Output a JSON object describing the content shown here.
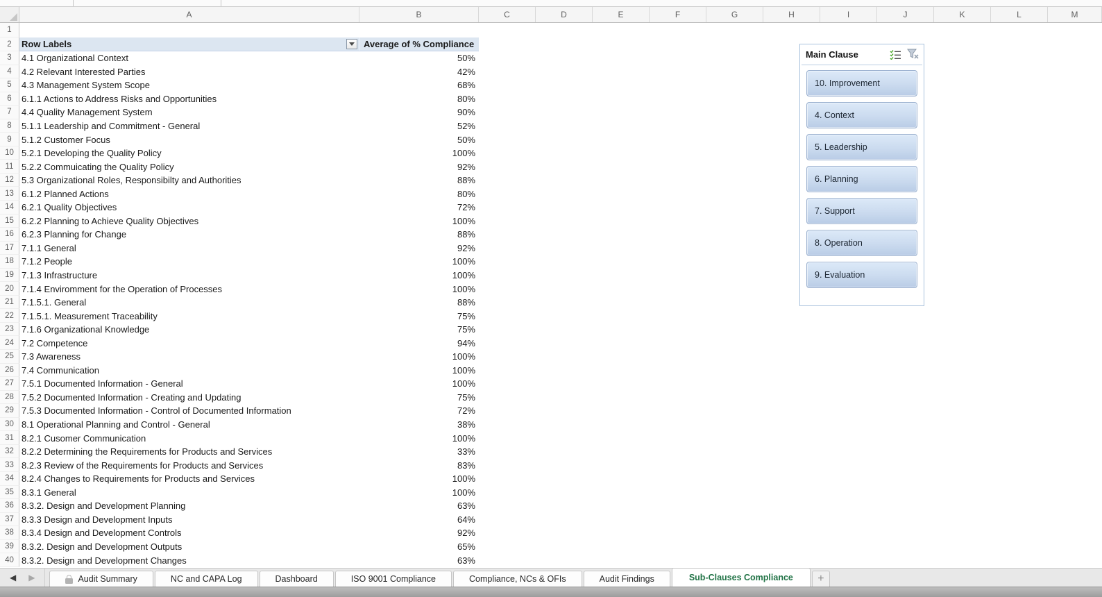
{
  "spreadsheet": {
    "column_letters": [
      "A",
      "B",
      "C",
      "D",
      "E",
      "F",
      "G",
      "H",
      "I",
      "J",
      "K",
      "L",
      "M"
    ],
    "first_row_number": 1,
    "last_row_number": 40
  },
  "pivot_table": {
    "filter_header": "Row Labels",
    "value_header": "Average of % Compliance",
    "rows": [
      {
        "label": "4.1 Organizational Context",
        "value": "50%"
      },
      {
        "label": "4.2 Relevant Interested Parties",
        "value": "42%"
      },
      {
        "label": "4.3 Management System Scope",
        "value": "68%"
      },
      {
        "label": "6.1.1 Actions to Address Risks and Opportunities",
        "value": "80%"
      },
      {
        "label": "4.4 Quality Management System",
        "value": "90%"
      },
      {
        "label": "5.1.1 Leadership and Commitment - General",
        "value": "52%"
      },
      {
        "label": "5.1.2 Customer Focus",
        "value": "50%"
      },
      {
        "label": "5.2.1 Developing the Quality Policy",
        "value": "100%"
      },
      {
        "label": "5.2.2 Commuicating the Quality Policy",
        "value": "92%"
      },
      {
        "label": "5.3 Organizational Roles, Responsibilty and Authorities",
        "value": "88%"
      },
      {
        "label": "6.1.2 Planned Actions",
        "value": "80%"
      },
      {
        "label": "6.2.1 Quality Objectives",
        "value": "72%"
      },
      {
        "label": "6.2.2 Planning to Achieve Quality Objectives",
        "value": "100%"
      },
      {
        "label": "6.2.3 Planning for Change",
        "value": "88%"
      },
      {
        "label": "7.1.1 General",
        "value": "92%"
      },
      {
        "label": "7.1.2 People",
        "value": "100%"
      },
      {
        "label": "7.1.3 Infrastructure",
        "value": "100%"
      },
      {
        "label": "7.1.4 Enviromment for the Operation of Processes",
        "value": "100%"
      },
      {
        "label": "7.1.5.1. General",
        "value": "88%"
      },
      {
        "label": "7.1.5.1. Measurement Traceability",
        "value": "75%"
      },
      {
        "label": "7.1.6 Organizational Knowledge",
        "value": "75%"
      },
      {
        "label": "7.2 Competence",
        "value": "94%"
      },
      {
        "label": "7.3 Awareness",
        "value": "100%"
      },
      {
        "label": "7.4 Communication",
        "value": "100%"
      },
      {
        "label": "7.5.1 Documented Information - General",
        "value": "100%"
      },
      {
        "label": "7.5.2 Documented Information - Creating and Updating",
        "value": "75%"
      },
      {
        "label": "7.5.3 Documented Information - Control of Documented Information",
        "value": "72%"
      },
      {
        "label": "8.1 Operational Planning and Control - General",
        "value": "38%"
      },
      {
        "label": "8.2.1 Cusomer Communication",
        "value": "100%"
      },
      {
        "label": "8.2.2 Determining the Requirements for Products and Services",
        "value": "33%"
      },
      {
        "label": "8.2.3 Review of the Requirements for Products and Services",
        "value": "83%"
      },
      {
        "label": "8.2.4 Changes to Requirements for Products and Services",
        "value": "100%"
      },
      {
        "label": "8.3.1 General",
        "value": "100%"
      },
      {
        "label": "8.3.2. Design and Development Planning",
        "value": "63%"
      },
      {
        "label": "8.3.3 Design and Development Inputs",
        "value": "64%"
      },
      {
        "label": "8.3.4 Design and Development Controls",
        "value": "92%"
      },
      {
        "label": "8.3.2. Design and Development Outputs",
        "value": "65%"
      },
      {
        "label": "8.3.2. Design and Development Changes",
        "value": "63%"
      }
    ]
  },
  "slicer": {
    "title": "Main Clause",
    "icons": [
      "multi-select-icon",
      "clear-filter-icon"
    ],
    "buttons": [
      "10. Improvement",
      "4. Context",
      "5. Leadership",
      "6. Planning",
      "7. Support",
      "8. Operation",
      "9. Evaluation"
    ]
  },
  "sheet_tabs": {
    "tabs": [
      {
        "label": "Audit Summary",
        "locked": true,
        "active": false
      },
      {
        "label": "NC and CAPA Log",
        "locked": false,
        "active": false
      },
      {
        "label": "Dashboard",
        "locked": false,
        "active": false
      },
      {
        "label": "ISO 9001 Compliance",
        "locked": false,
        "active": false
      },
      {
        "label": "Compliance, NCs & OFIs",
        "locked": false,
        "active": false
      },
      {
        "label": "Audit Findings",
        "locked": false,
        "active": false
      },
      {
        "label": "Sub-Clauses Compliance",
        "locked": false,
        "active": true
      }
    ],
    "add_label": "+"
  },
  "colors": {
    "pivot_header_bg": "#dce6f1",
    "active_tab_text": "#217346",
    "slicer_button_top": "#dce9f8",
    "slicer_button_bottom": "#b9cce6",
    "slicer_border": "#a9c2dd"
  }
}
